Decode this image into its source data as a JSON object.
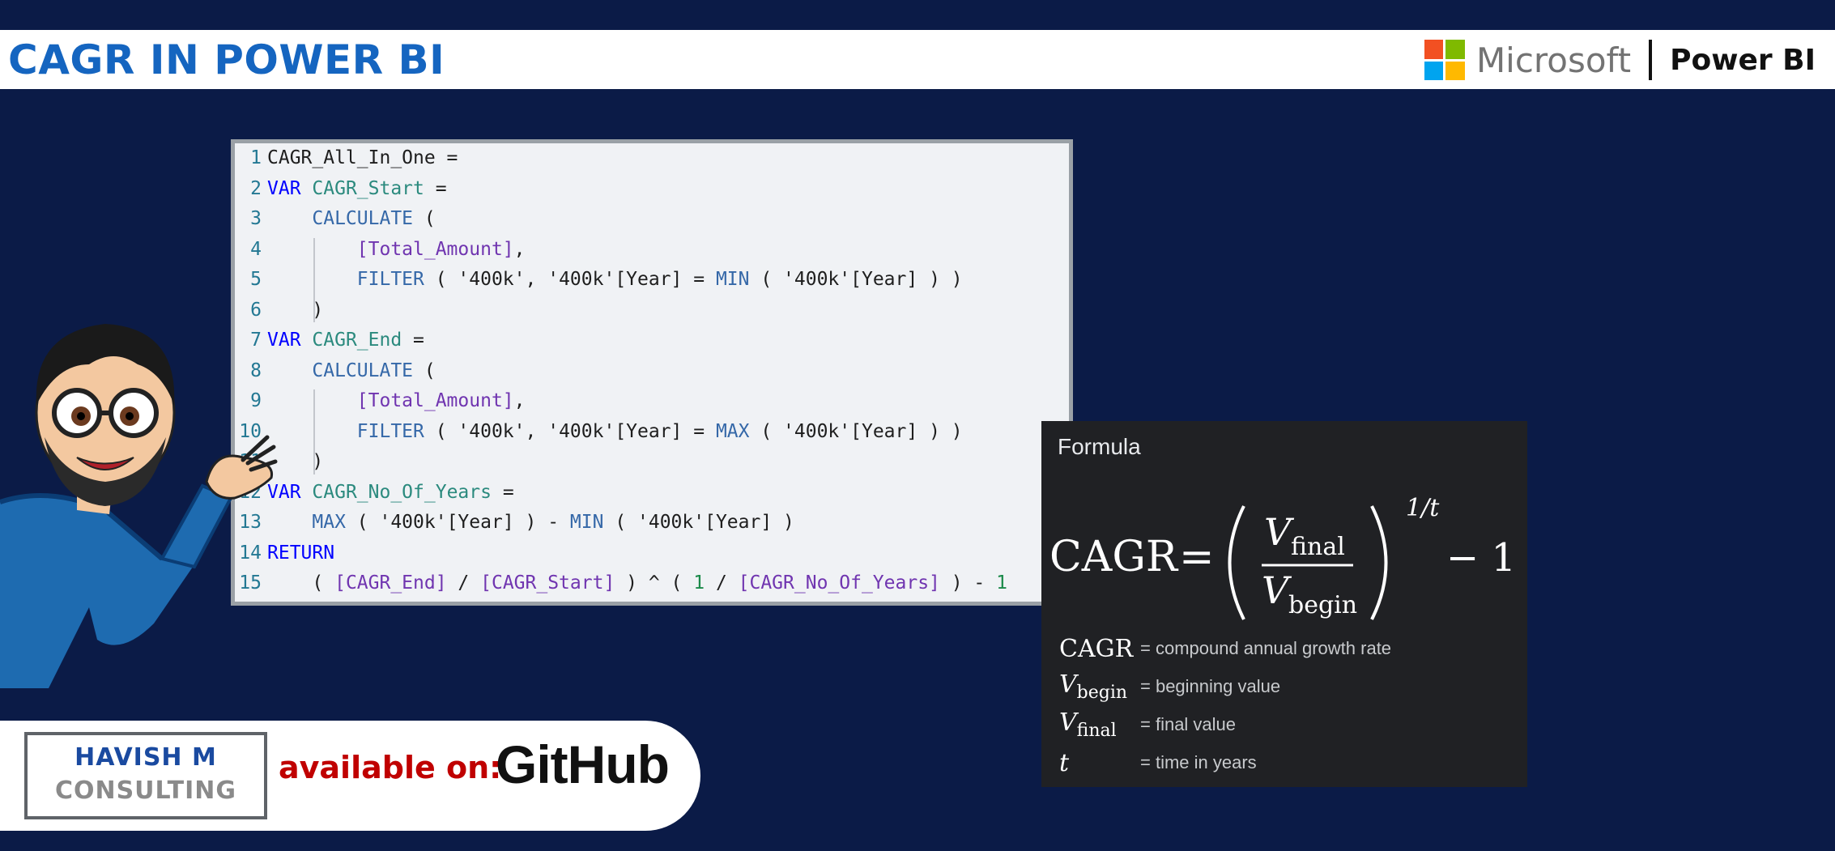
{
  "header": {
    "title": "CAGR IN POWER BI",
    "brand_microsoft": "Microsoft",
    "brand_product": "Power BI",
    "logo_colors": [
      "#f25022",
      "#7fba00",
      "#00a4ef",
      "#ffb900"
    ]
  },
  "code": {
    "lines": [
      {
        "num": "1",
        "text": "CAGR_All_In_One ="
      },
      {
        "num": "2",
        "text": "VAR CAGR_Start ="
      },
      {
        "num": "3",
        "text": "    CALCULATE ("
      },
      {
        "num": "4",
        "text": "        [Total_Amount],"
      },
      {
        "num": "5",
        "text": "        FILTER ( '400k', '400k'[Year] = MIN ( '400k'[Year] ) )"
      },
      {
        "num": "6",
        "text": "    )"
      },
      {
        "num": "7",
        "text": "VAR CAGR_End ="
      },
      {
        "num": "8",
        "text": "    CALCULATE ("
      },
      {
        "num": "9",
        "text": "        [Total_Amount],"
      },
      {
        "num": "10",
        "text": "        FILTER ( '400k', '400k'[Year] = MAX ( '400k'[Year] ) )"
      },
      {
        "num": "11",
        "text": "    )"
      },
      {
        "num": "12",
        "text": "VAR CAGR_No_Of_Years ="
      },
      {
        "num": "13",
        "text": "    MAX ( '400k'[Year] ) - MIN ( '400k'[Year] )"
      },
      {
        "num": "14",
        "text": "RETURN"
      },
      {
        "num": "15",
        "text": "    ( [CAGR_End] / [CAGR_Start] ) ^ ( 1 / [CAGR_No_Of_Years] ) - 1"
      }
    ]
  },
  "formula": {
    "label": "Formula",
    "lhs": "CAGR",
    "equals": "=",
    "numerator_var": "V",
    "numerator_sub": "final",
    "denominator_var": "V",
    "denominator_sub": "begin",
    "exponent": "1/t",
    "minus_one": "− 1",
    "definitions": [
      {
        "symbol": "CAGR",
        "sub": "",
        "text": "= compound annual growth rate"
      },
      {
        "symbol": "V",
        "sub": "begin",
        "text": "= beginning value"
      },
      {
        "symbol": "V",
        "sub": "final",
        "text": "= final value"
      },
      {
        "symbol": "t",
        "sub": "",
        "text": "= time in years"
      }
    ]
  },
  "footer": {
    "consulting_line1": "HAVISH M",
    "consulting_line2": "CONSULTING",
    "available_text": "available on:",
    "platform": "GitHub"
  },
  "icons": {
    "avatar": "cartoon-presenter-icon",
    "logo": "microsoft-logo-icon"
  }
}
